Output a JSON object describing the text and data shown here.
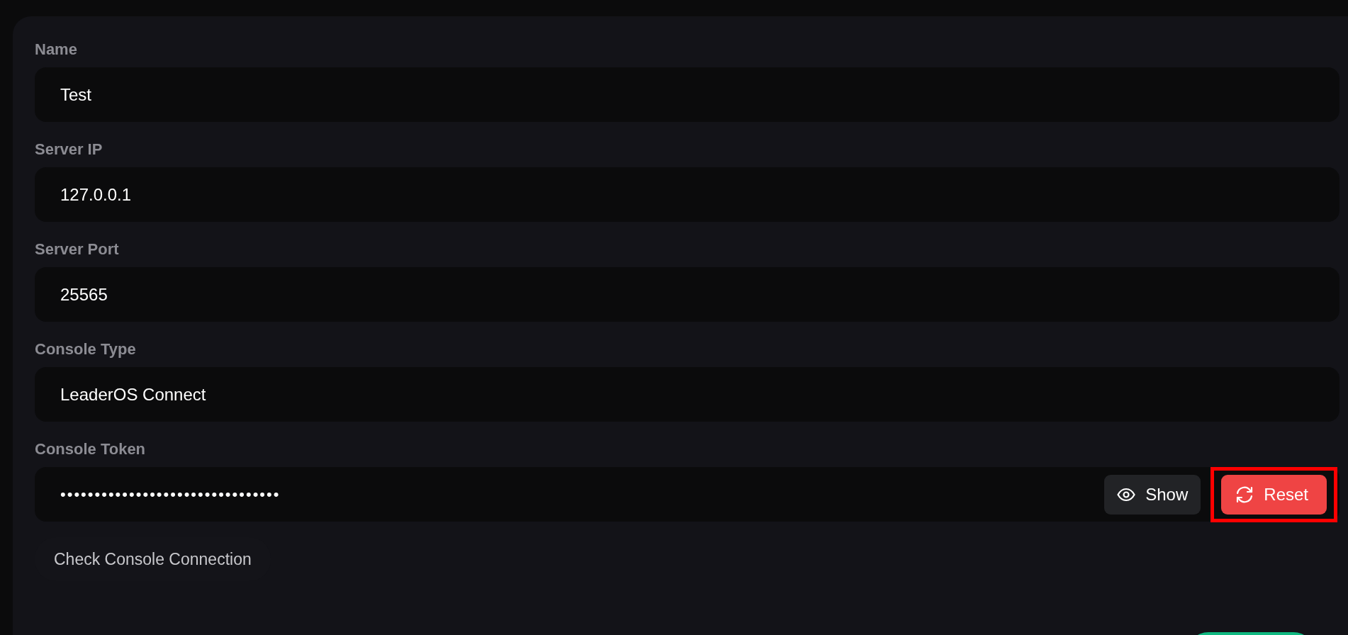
{
  "fields": [
    {
      "label": "Name",
      "value": "Test",
      "kind": "text"
    },
    {
      "label": "Server IP",
      "value": "127.0.0.1",
      "kind": "text"
    },
    {
      "label": "Server Port",
      "value": "25565",
      "kind": "text"
    },
    {
      "label": "Console Type",
      "value": "LeaderOS Connect",
      "kind": "select"
    },
    {
      "label": "Console Token",
      "value": "••••••••••••••••••••••••••••••••",
      "kind": "secret",
      "show_button": "Show",
      "reset_button": "Reset",
      "reset_highlighted": true
    }
  ],
  "check_button": "Check Console Connection"
}
